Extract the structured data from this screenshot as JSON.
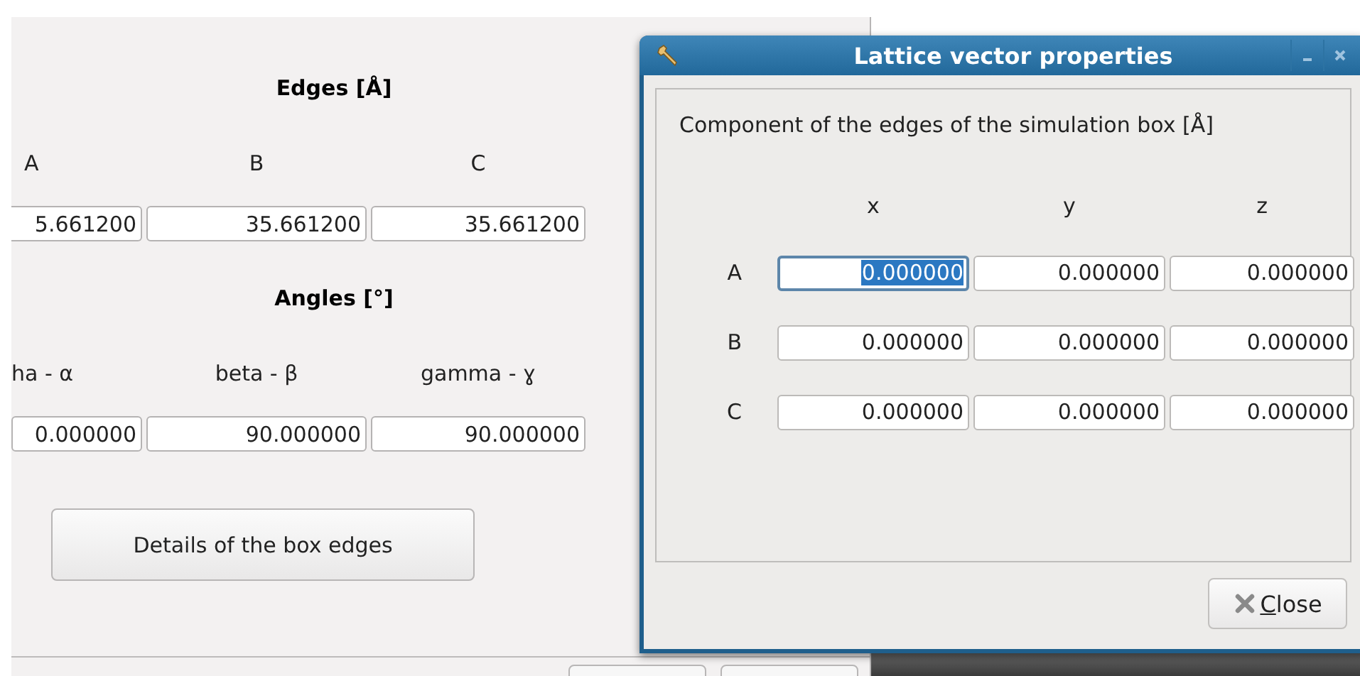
{
  "main_panel": {
    "edges_heading": "Edges [Å]",
    "edge_labels": [
      "A",
      "B",
      "C"
    ],
    "edge_values": [
      "5.661200",
      "35.661200",
      "35.661200"
    ],
    "angles_heading": "Angles [°]",
    "angle_labels": [
      "ha - α",
      "beta - β",
      "gamma - ɣ"
    ],
    "angle_values": [
      "0.000000",
      "90.000000",
      "90.000000"
    ],
    "details_button": "Details of the box edges"
  },
  "dialog": {
    "title": "Lattice vector properties",
    "group_title": "Component of the edges of the simulation box [Å]",
    "columns": [
      "x",
      "y",
      "z"
    ],
    "rows": [
      {
        "label": "A",
        "values": [
          {
            "value": "0.000000",
            "selected": true
          },
          {
            "value": "0.000000",
            "selected": false
          },
          {
            "value": "0.000000",
            "selected": false
          }
        ]
      },
      {
        "label": "B",
        "values": [
          {
            "value": "0.000000",
            "selected": false
          },
          {
            "value": "0.000000",
            "selected": false
          },
          {
            "value": "0.000000",
            "selected": false
          }
        ]
      },
      {
        "label": "C",
        "values": [
          {
            "value": "0.000000",
            "selected": false
          },
          {
            "value": "0.000000",
            "selected": false
          },
          {
            "value": "0.000000",
            "selected": false
          }
        ]
      }
    ],
    "close_button": {
      "label": "Close"
    }
  }
}
